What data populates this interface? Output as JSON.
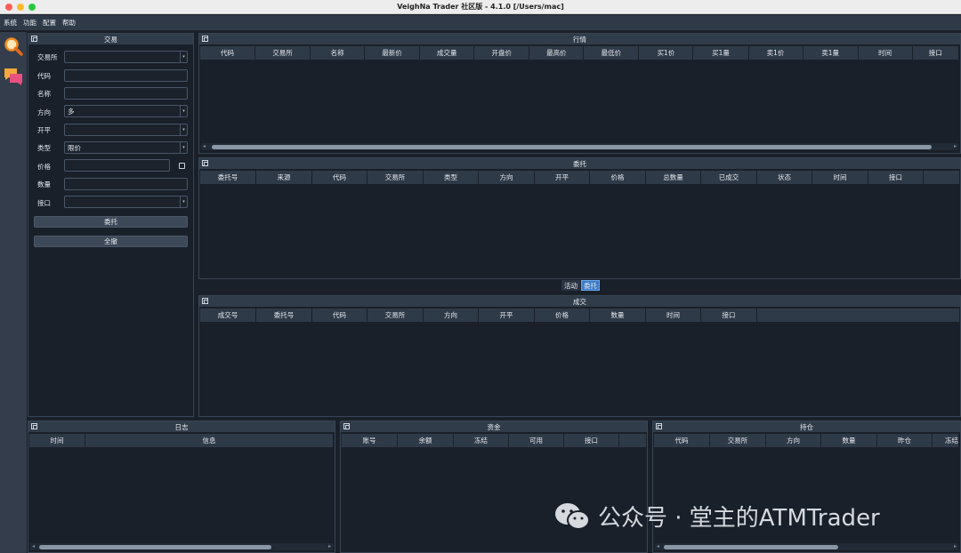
{
  "window": {
    "title": "VeighNa Trader 社区版 - 4.1.0  [/Users/mac]"
  },
  "menubar": {
    "items": [
      "系统",
      "功能",
      "配置",
      "帮助"
    ]
  },
  "toolbar": {
    "icons": [
      "search-icon",
      "chat-icon"
    ]
  },
  "trade_panel": {
    "title": "交易",
    "labels": {
      "exchange": "交易所",
      "symbol": "代码",
      "name": "名称",
      "direction": "方向",
      "offset": "开平",
      "type": "类型",
      "price": "价格",
      "volume": "数量",
      "gateway": "接口"
    },
    "values": {
      "exchange": "",
      "symbol": "",
      "name": "",
      "direction": "多",
      "offset": "",
      "type": "限价",
      "price": "",
      "volume": "",
      "gateway": ""
    },
    "send_button": "委托",
    "cancel_all_button": "全撤"
  },
  "tick_panel": {
    "title": "行情",
    "columns": [
      "代码",
      "交易所",
      "名称",
      "最新价",
      "成交量",
      "开盘价",
      "最高价",
      "最低价",
      "买1价",
      "买1量",
      "卖1价",
      "卖1量",
      "时间",
      "接口"
    ]
  },
  "order_panel": {
    "title": "委托",
    "columns": [
      "委托号",
      "来源",
      "代码",
      "交易所",
      "类型",
      "方向",
      "开平",
      "价格",
      "总数量",
      "已成交",
      "状态",
      "时间",
      "接口"
    ],
    "tabs": [
      "活动",
      "委托"
    ],
    "active_tab": "委托"
  },
  "trade_list_panel": {
    "title": "成交",
    "columns": [
      "成交号",
      "委托号",
      "代码",
      "交易所",
      "方向",
      "开平",
      "价格",
      "数量",
      "时间",
      "接口"
    ]
  },
  "log_panel": {
    "title": "日志",
    "columns": [
      "时间",
      "信息"
    ]
  },
  "account_panel": {
    "title": "资金",
    "columns": [
      "账号",
      "余额",
      "冻结",
      "可用",
      "接口"
    ]
  },
  "position_panel": {
    "title": "持仓",
    "columns": [
      "代码",
      "交易所",
      "方向",
      "数量",
      "昨仓",
      "冻结"
    ]
  },
  "watermark": {
    "text": "公众号 · 堂主的ATMTrader"
  }
}
